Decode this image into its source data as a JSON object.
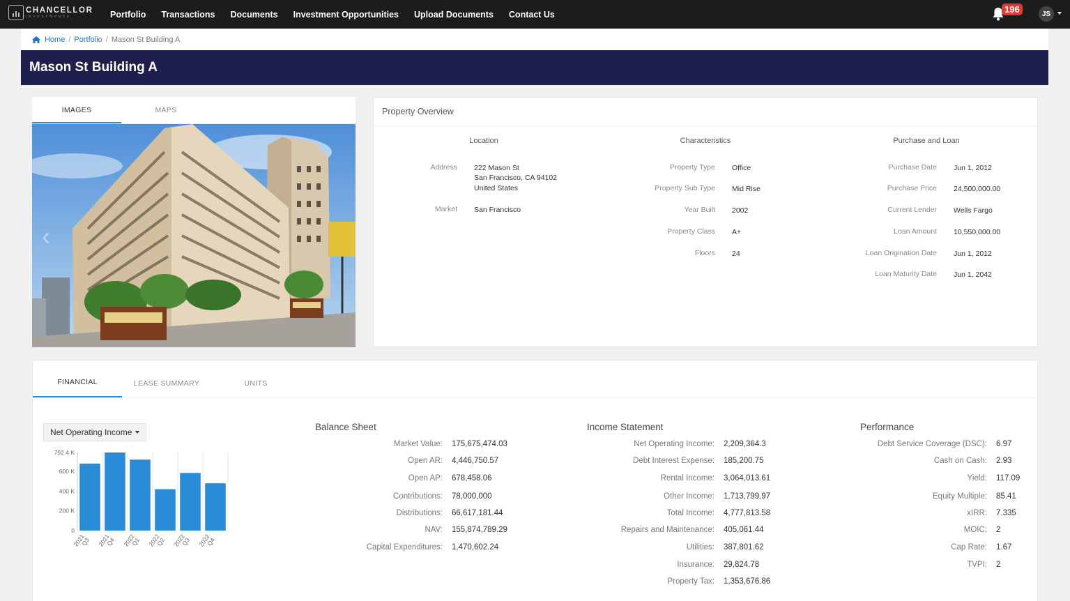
{
  "brand": {
    "name": "CHANCELLOR",
    "tagline": "INVESTMENTS"
  },
  "nav": {
    "links": [
      "Portfolio",
      "Transactions",
      "Documents",
      "Investment Opportunities",
      "Upload Documents",
      "Contact Us"
    ],
    "notification_count": "196",
    "user_initials": "JS"
  },
  "breadcrumb": {
    "home": "Home",
    "portfolio": "Portfolio",
    "current": "Mason St Building A"
  },
  "page_title": "Mason St Building A",
  "media_tabs": [
    "IMAGES",
    "MAPS"
  ],
  "overview": {
    "title": "Property Overview",
    "location": {
      "heading": "Location",
      "address_label": "Address",
      "address_lines": [
        "222 Mason St",
        "San Francisco, CA 94102",
        "United States"
      ],
      "market_label": "Market",
      "market": "San Francisco"
    },
    "characteristics": {
      "heading": "Characteristics",
      "rows": [
        {
          "label": "Property Type",
          "value": "Office"
        },
        {
          "label": "Property Sub Type",
          "value": "Mid Rise"
        },
        {
          "label": "Year Built",
          "value": "2002"
        },
        {
          "label": "Property Class",
          "value": "A+"
        },
        {
          "label": "Floors",
          "value": "24"
        }
      ]
    },
    "purchase": {
      "heading": "Purchase and Loan",
      "rows": [
        {
          "label": "Purchase Date",
          "value": "Jun 1, 2012"
        },
        {
          "label": "Purchase Price",
          "value": "24,500,000.00"
        },
        {
          "label": "Current Lender",
          "value": "Wells Fargo"
        },
        {
          "label": "Loan Amount",
          "value": "10,550,000.00"
        },
        {
          "label": "Loan Origination Date",
          "value": "Jun 1, 2012"
        },
        {
          "label": "Loan Maturity Date",
          "value": "Jun 1, 2042"
        }
      ]
    }
  },
  "bottom_tabs": [
    "FINANCIAL",
    "LEASE SUMMARY",
    "UNITS"
  ],
  "metric_select": "Net Operating Income",
  "chart_data": {
    "type": "bar",
    "categories": [
      "2021 Q3",
      "2021 Q4",
      "2022 Q1",
      "2022 Q2",
      "2022 Q3",
      "2022 Q4"
    ],
    "values": [
      680000,
      792400,
      720000,
      420000,
      585000,
      480000
    ],
    "yticks": [
      "0",
      "200 K",
      "400 K",
      "600 K",
      "792.4 K"
    ],
    "ylim": [
      0,
      792400
    ],
    "color": "#2a8bd6",
    "grid": true
  },
  "balance_sheet": {
    "title": "Balance Sheet",
    "rows": [
      {
        "label": "Market Value:",
        "value": "175,675,474.03"
      },
      {
        "label": "Open AR:",
        "value": "4,446,750.57"
      },
      {
        "label": "Open AP:",
        "value": "678,458.06"
      },
      {
        "label": "Contributions:",
        "value": "78,000,000"
      },
      {
        "label": "Distributions:",
        "value": "66,617,181.44"
      },
      {
        "label": "NAV:",
        "value": "155,874,789.29"
      },
      {
        "label": "Capital Expenditures:",
        "value": "1,470,602.24"
      }
    ]
  },
  "income_statement": {
    "title": "Income Statement",
    "rows": [
      {
        "label": "Net Operating Income:",
        "value": "2,209,364.3"
      },
      {
        "label": "Debt Interest Expense:",
        "value": "185,200.75"
      },
      {
        "label": "Rental Income:",
        "value": "3,064,013.61"
      },
      {
        "label": "Other Income:",
        "value": "1,713,799.97"
      },
      {
        "label": "Total Income:",
        "value": "4,777,813.58"
      },
      {
        "label": "Repairs and Maintenance:",
        "value": "405,061.44"
      },
      {
        "label": "Utilities:",
        "value": "387,801.62"
      },
      {
        "label": "Insurance:",
        "value": "29,824.78"
      },
      {
        "label": "Property Tax:",
        "value": "1,353,676.86"
      }
    ]
  },
  "performance": {
    "title": "Performance",
    "rows": [
      {
        "label": "Debt Service Coverage (DSC):",
        "value": "6.97"
      },
      {
        "label": "Cash on Cash:",
        "value": "2.93"
      },
      {
        "label": "Yield:",
        "value": "117.09"
      },
      {
        "label": "Equity Multiple:",
        "value": "85.41"
      },
      {
        "label": "xIRR:",
        "value": "7.335"
      },
      {
        "label": "MOIC:",
        "value": "2"
      },
      {
        "label": "Cap Rate:",
        "value": "1.67"
      },
      {
        "label": "TVPI:",
        "value": "2"
      }
    ]
  }
}
